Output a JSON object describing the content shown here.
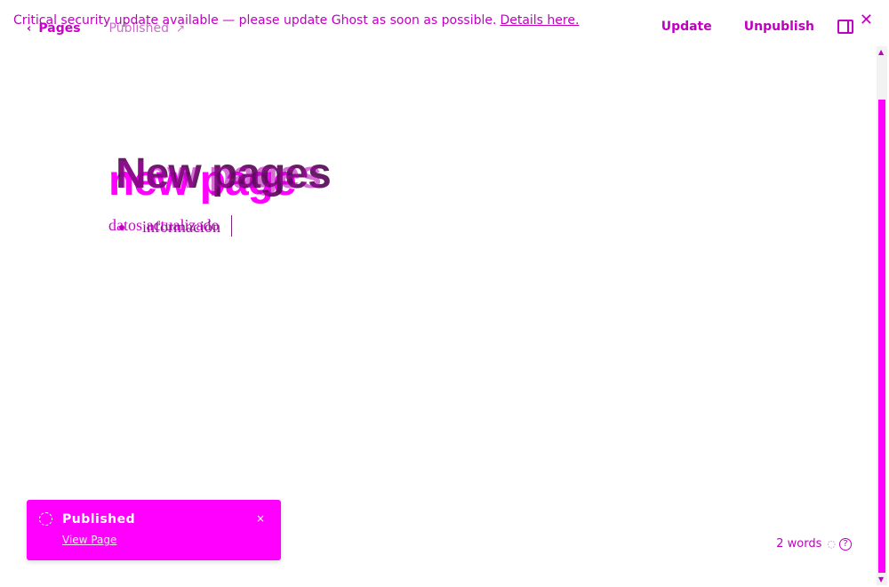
{
  "banner": {
    "text": "Critical security update available — please update Ghost as soon as possible.",
    "link": "Details here."
  },
  "header": {
    "back_label": "Pages",
    "status_label": "Published",
    "update_label": "Update",
    "unpublish_label": "Unpublish"
  },
  "editor": {
    "title": "New pages",
    "title_overlay": "new page",
    "body_ghost": "datos actualizado",
    "body_text": "información"
  },
  "wordcount": {
    "text": "2 words"
  },
  "toast": {
    "title": "Published",
    "link": "View Page",
    "close": "×"
  },
  "icons": {
    "back": "chevron-left-icon",
    "external": "external-link-icon",
    "settings": "sidebar-toggle-icon",
    "close": "close-icon",
    "help": "help-circle-icon",
    "toast_status": "spinner-icon"
  },
  "colors": {
    "accent": "#ff00ff",
    "text_accent": "#c000c0"
  }
}
